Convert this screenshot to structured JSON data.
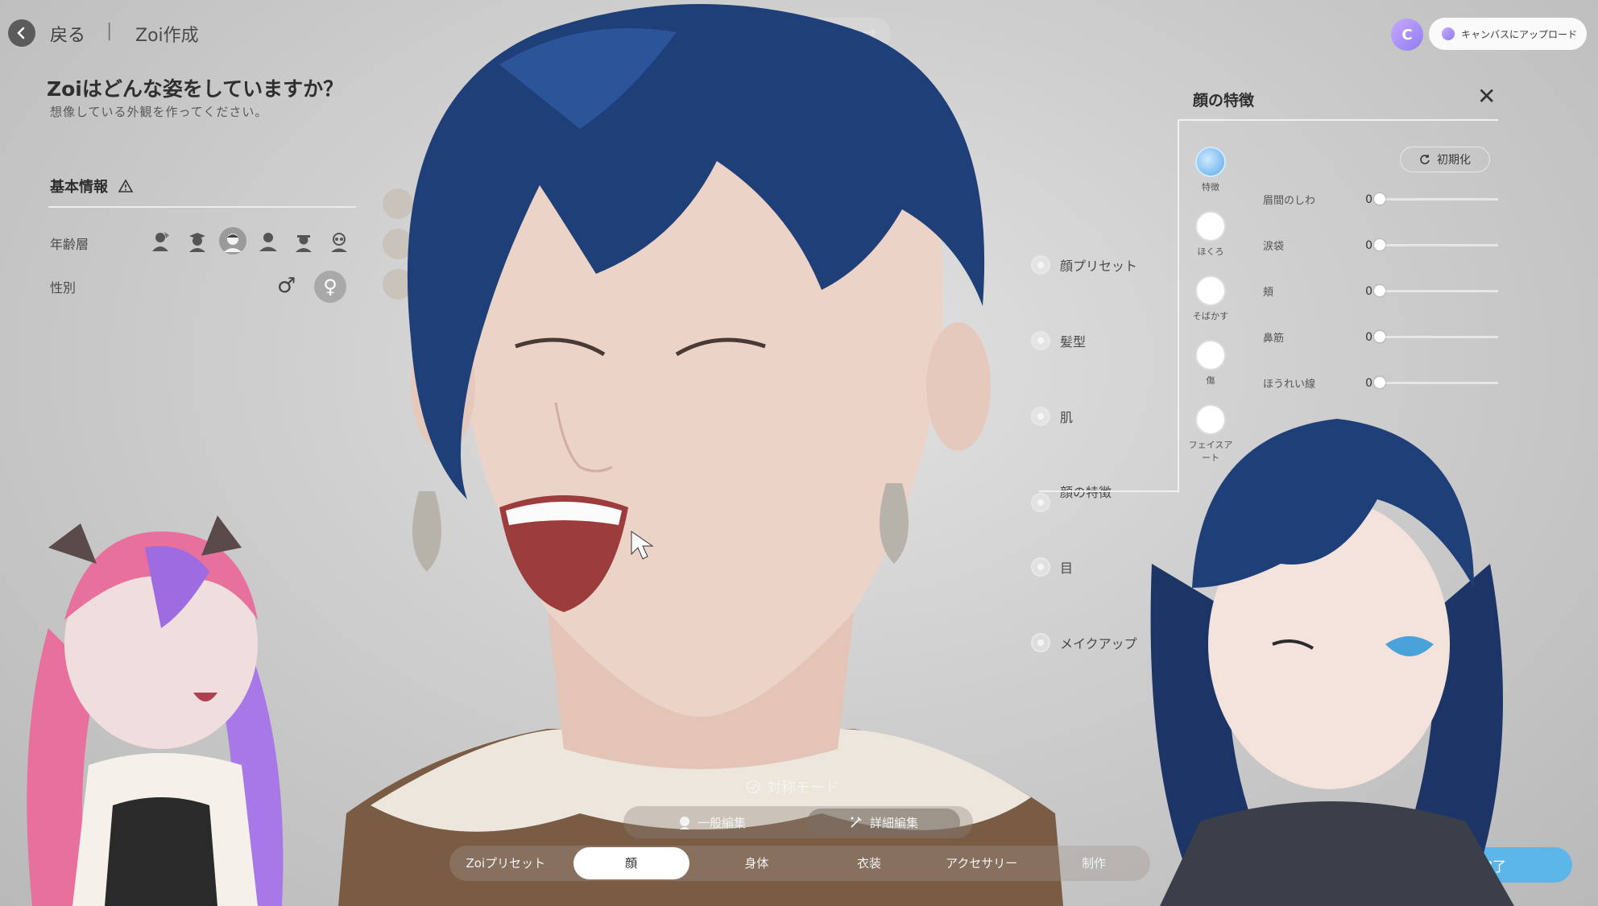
{
  "nav": {
    "back_label": "戻る",
    "separator": "|",
    "title": "Zoi作成"
  },
  "page": {
    "heading": "Zoiはどんな姿をしていますか？",
    "subheading": "想像している外観を作ってください。"
  },
  "basic_info": {
    "title": "基本情報",
    "age_label": "年齢層",
    "gender_label": "性別",
    "male_symbol": "♂",
    "female_symbol": "♀"
  },
  "upload": {
    "label": "キャンバスにアップロード",
    "brand_letter": "C"
  },
  "categories": [
    {
      "label": "顔プリセット"
    },
    {
      "label": "髪型"
    },
    {
      "label": "肌"
    },
    {
      "label": "顔の特徴"
    },
    {
      "label": "目"
    },
    {
      "label": "メイクアップ"
    }
  ],
  "panel": {
    "title": "顔の特徴",
    "close": "✕",
    "reset_label": "初期化",
    "side_tabs": [
      {
        "label": "特徴",
        "active": true
      },
      {
        "label": "ほくろ"
      },
      {
        "label": "そばかす"
      },
      {
        "label": "傷"
      },
      {
        "label": "フェイスア ート"
      }
    ],
    "sliders": [
      {
        "label": "眉間のしわ",
        "value": "0"
      },
      {
        "label": "涙袋",
        "value": "0"
      },
      {
        "label": "頬",
        "value": "0"
      },
      {
        "label": "鼻筋",
        "value": "0"
      },
      {
        "label": "ほうれい線",
        "value": "0"
      }
    ]
  },
  "symmetry": {
    "label": "対称モード"
  },
  "edit_modes": [
    {
      "label": "一般編集"
    },
    {
      "label": "詳細編集",
      "active": true
    }
  ],
  "bottom_tabs": [
    {
      "label": "Zoiプリセット"
    },
    {
      "label": "顔",
      "active": true
    },
    {
      "label": "身体"
    },
    {
      "label": "衣装"
    },
    {
      "label": "アクセサリー"
    },
    {
      "label": "制作"
    }
  ],
  "done_label": "完了",
  "colors": {
    "accent": "#5cb6ea",
    "hair": "#1f3f78",
    "skin": "#e9cfc4"
  }
}
